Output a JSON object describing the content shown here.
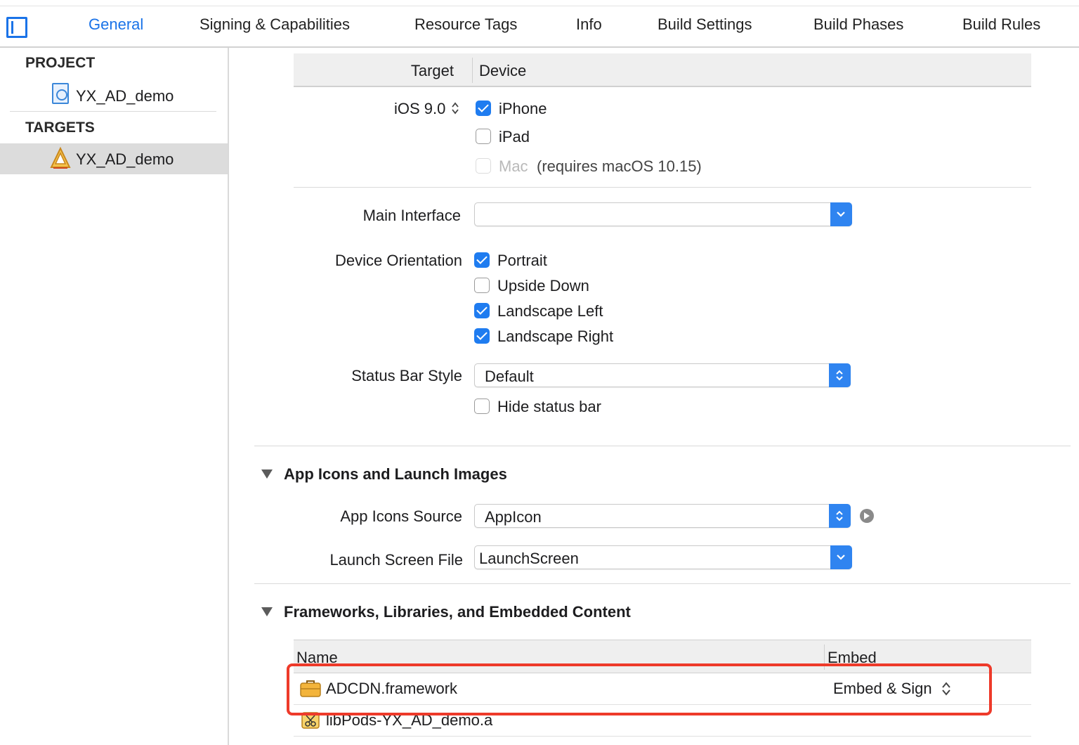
{
  "tabs": [
    {
      "label": "General",
      "active": true
    },
    {
      "label": "Signing & Capabilities"
    },
    {
      "label": "Resource Tags"
    },
    {
      "label": "Info"
    },
    {
      "label": "Build Settings"
    },
    {
      "label": "Build Phases"
    },
    {
      "label": "Build Rules"
    }
  ],
  "sidebar": {
    "project_heading": "PROJECT",
    "project_item": "YX_AD_demo",
    "targets_heading": "TARGETS",
    "target_item": "YX_AD_demo"
  },
  "deployment": {
    "header_target": "Target",
    "header_device": "Device",
    "ios_version": "iOS 9.0",
    "devices": [
      {
        "label": "iPhone",
        "checked": true
      },
      {
        "label": "iPad",
        "checked": false
      },
      {
        "label": "Mac",
        "checked": false,
        "disabled": true,
        "note": "(requires macOS 10.15)"
      }
    ]
  },
  "main_interface": {
    "label": "Main Interface",
    "value": ""
  },
  "device_orientation": {
    "label": "Device Orientation",
    "options": [
      {
        "label": "Portrait",
        "checked": true
      },
      {
        "label": "Upside Down",
        "checked": false
      },
      {
        "label": "Landscape Left",
        "checked": true
      },
      {
        "label": "Landscape Right",
        "checked": true
      }
    ]
  },
  "status_bar": {
    "label": "Status Bar Style",
    "value": "Default",
    "hide_label": "Hide status bar",
    "hide_checked": false
  },
  "app_icons_section": {
    "title": "App Icons and Launch Images",
    "icons_source_label": "App Icons Source",
    "icons_source_value": "AppIcon",
    "launch_screen_label": "Launch Screen File",
    "launch_screen_value": "LaunchScreen"
  },
  "frameworks_section": {
    "title": "Frameworks, Libraries, and Embedded Content",
    "col_name": "Name",
    "col_embed": "Embed",
    "rows": [
      {
        "name": "ADCDN.framework",
        "embed": "Embed & Sign"
      },
      {
        "name": "libPods-YX_AD_demo.a",
        "embed": ""
      }
    ]
  },
  "colors": {
    "accent": "#1a73e8",
    "checkbox_blue": "#1f7cf0",
    "highlight_red": "#ee3a2a"
  }
}
